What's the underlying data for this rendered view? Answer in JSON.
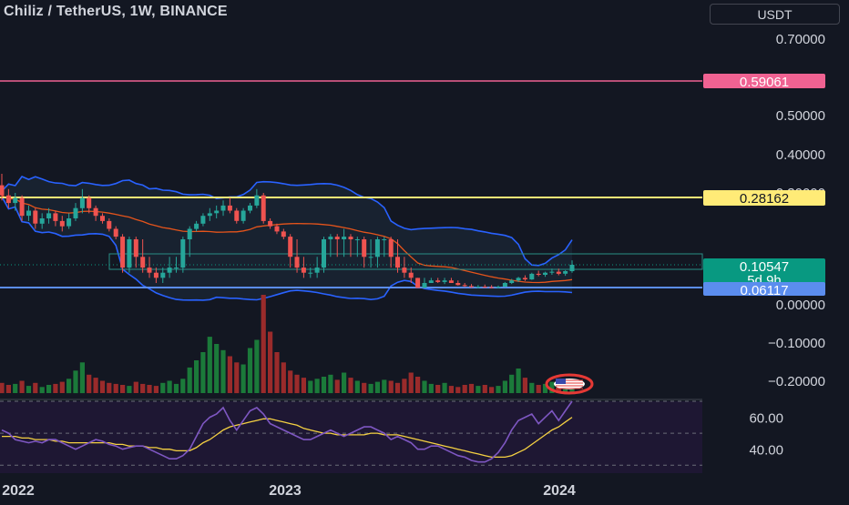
{
  "header": {
    "title": "Chiliz / TetherUS, 1W, BINANCE",
    "currency_label": "USDT"
  },
  "colors": {
    "background": "#131722",
    "up": "#26a69a",
    "down": "#ef5350",
    "bollinger": "#2962ff",
    "bollinger_fill": "#1e2b3d",
    "ma": "#e5541b",
    "rsi": "#7e57c2",
    "rsi_ma": "#f5d142",
    "resistance_pink": "#f06292",
    "resistance_yellow": "#ffeb77",
    "support_blue": "#5b8def",
    "last_price": "#089981"
  },
  "price_axis": {
    "ticks": [
      "0.70000",
      "0.50000",
      "0.40000",
      "0.30000",
      "0.00000",
      "−0.10000",
      "−0.20000"
    ]
  },
  "price_labels": {
    "pink": "0.59061",
    "yellow": "0.28162",
    "last": "0.10547",
    "countdown": "5d 9h",
    "blue": "0.06117"
  },
  "rsi_axis": {
    "ticks": [
      "60.00",
      "40.00"
    ]
  },
  "time_axis": {
    "labels": [
      "2022",
      "2023",
      "2024"
    ]
  },
  "chart_data": {
    "type": "candlestick",
    "title": "Chiliz / TetherUS, 1W, BINANCE",
    "horizontal_levels": [
      0.59061,
      0.28162,
      0.06117
    ],
    "last_price": 0.10547,
    "ylim": [
      -0.22,
      0.74
    ],
    "ohlc": [
      [
        0.32,
        0.35,
        0.27,
        0.29
      ],
      [
        0.29,
        0.31,
        0.24,
        0.26
      ],
      [
        0.26,
        0.3,
        0.23,
        0.28
      ],
      [
        0.28,
        0.29,
        0.19,
        0.21
      ],
      [
        0.21,
        0.25,
        0.19,
        0.23
      ],
      [
        0.23,
        0.24,
        0.16,
        0.18
      ],
      [
        0.18,
        0.22,
        0.16,
        0.2
      ],
      [
        0.2,
        0.24,
        0.18,
        0.22
      ],
      [
        0.22,
        0.23,
        0.17,
        0.19
      ],
      [
        0.19,
        0.21,
        0.15,
        0.17
      ],
      [
        0.17,
        0.22,
        0.16,
        0.2
      ],
      [
        0.2,
        0.26,
        0.19,
        0.24
      ],
      [
        0.24,
        0.31,
        0.22,
        0.28
      ],
      [
        0.28,
        0.29,
        0.22,
        0.24
      ],
      [
        0.24,
        0.25,
        0.19,
        0.21
      ],
      [
        0.21,
        0.22,
        0.18,
        0.19
      ],
      [
        0.19,
        0.2,
        0.15,
        0.16
      ],
      [
        0.16,
        0.17,
        0.12,
        0.13
      ],
      [
        0.13,
        0.14,
        0.09,
        0.1
      ],
      [
        0.1,
        0.13,
        0.09,
        0.12
      ],
      [
        0.12,
        0.13,
        0.1,
        0.11
      ],
      [
        0.11,
        0.12,
        0.09,
        0.1
      ],
      [
        0.1,
        0.11,
        0.08,
        0.09
      ],
      [
        0.09,
        0.1,
        0.07,
        0.08
      ],
      [
        0.08,
        0.1,
        0.07,
        0.09
      ],
      [
        0.09,
        0.11,
        0.08,
        0.1
      ],
      [
        0.1,
        0.11,
        0.09,
        0.1
      ],
      [
        0.1,
        0.13,
        0.09,
        0.12
      ],
      [
        0.12,
        0.17,
        0.11,
        0.16
      ],
      [
        0.16,
        0.19,
        0.15,
        0.18
      ],
      [
        0.18,
        0.22,
        0.17,
        0.21
      ],
      [
        0.21,
        0.24,
        0.19,
        0.22
      ],
      [
        0.22,
        0.25,
        0.2,
        0.23
      ],
      [
        0.23,
        0.27,
        0.21,
        0.25
      ],
      [
        0.25,
        0.28,
        0.22,
        0.23
      ],
      [
        0.23,
        0.24,
        0.18,
        0.19
      ],
      [
        0.19,
        0.24,
        0.18,
        0.23
      ],
      [
        0.23,
        0.26,
        0.22,
        0.25
      ],
      [
        0.25,
        0.31,
        0.24,
        0.29
      ],
      [
        0.29,
        0.3,
        0.18,
        0.19
      ],
      [
        0.19,
        0.2,
        0.16,
        0.17
      ],
      [
        0.17,
        0.18,
        0.14,
        0.15
      ],
      [
        0.15,
        0.16,
        0.12,
        0.13
      ],
      [
        0.13,
        0.14,
        0.1,
        0.11
      ],
      [
        0.11,
        0.12,
        0.09,
        0.1
      ],
      [
        0.1,
        0.11,
        0.08,
        0.09
      ],
      [
        0.09,
        0.1,
        0.08,
        0.09
      ],
      [
        0.09,
        0.11,
        0.08,
        0.1
      ],
      [
        0.1,
        0.13,
        0.09,
        0.12
      ],
      [
        0.12,
        0.14,
        0.11,
        0.13
      ],
      [
        0.13,
        0.14,
        0.11,
        0.12
      ],
      [
        0.12,
        0.16,
        0.11,
        0.13
      ],
      [
        0.13,
        0.14,
        0.11,
        0.12
      ],
      [
        0.12,
        0.13,
        0.11,
        0.12
      ],
      [
        0.12,
        0.13,
        0.1,
        0.11
      ],
      [
        0.11,
        0.12,
        0.1,
        0.11
      ],
      [
        0.11,
        0.13,
        0.1,
        0.12
      ],
      [
        0.12,
        0.13,
        0.11,
        0.12
      ],
      [
        0.12,
        0.13,
        0.1,
        0.11
      ],
      [
        0.11,
        0.12,
        0.09,
        0.1
      ],
      [
        0.1,
        0.11,
        0.08,
        0.09
      ],
      [
        0.09,
        0.1,
        0.07,
        0.08
      ],
      [
        0.08,
        0.08,
        0.06,
        0.06
      ],
      [
        0.06,
        0.08,
        0.06,
        0.07
      ],
      [
        0.07,
        0.08,
        0.07,
        0.075
      ],
      [
        0.075,
        0.08,
        0.07,
        0.072
      ],
      [
        0.072,
        0.08,
        0.068,
        0.075
      ],
      [
        0.075,
        0.08,
        0.07,
        0.07
      ],
      [
        0.07,
        0.075,
        0.065,
        0.066
      ],
      [
        0.066,
        0.07,
        0.062,
        0.064
      ],
      [
        0.064,
        0.068,
        0.06,
        0.062
      ],
      [
        0.062,
        0.066,
        0.058,
        0.063
      ],
      [
        0.063,
        0.067,
        0.06,
        0.062
      ],
      [
        0.062,
        0.066,
        0.058,
        0.061
      ],
      [
        0.061,
        0.065,
        0.058,
        0.063
      ],
      [
        0.063,
        0.072,
        0.062,
        0.07
      ],
      [
        0.07,
        0.078,
        0.068,
        0.075
      ],
      [
        0.075,
        0.082,
        0.072,
        0.08
      ],
      [
        0.08,
        0.085,
        0.074,
        0.077
      ],
      [
        0.077,
        0.09,
        0.076,
        0.088
      ],
      [
        0.088,
        0.094,
        0.083,
        0.086
      ],
      [
        0.086,
        0.092,
        0.082,
        0.09
      ],
      [
        0.09,
        0.098,
        0.086,
        0.092
      ],
      [
        0.092,
        0.098,
        0.085,
        0.088
      ],
      [
        0.088,
        0.095,
        0.084,
        0.093
      ],
      [
        0.093,
        0.108,
        0.09,
        0.10547
      ]
    ],
    "volume": [
      10,
      8,
      9,
      12,
      7,
      10,
      6,
      8,
      9,
      11,
      14,
      22,
      30,
      18,
      15,
      12,
      10,
      9,
      8,
      7,
      11,
      9,
      8,
      7,
      10,
      12,
      9,
      14,
      25,
      32,
      40,
      55,
      48,
      42,
      36,
      30,
      28,
      44,
      52,
      96,
      60,
      40,
      30,
      22,
      18,
      15,
      12,
      14,
      16,
      18,
      13,
      20,
      15,
      12,
      10,
      9,
      11,
      13,
      12,
      10,
      14,
      20,
      16,
      12,
      9,
      8,
      10,
      7,
      6,
      8,
      9,
      7,
      8,
      6,
      7,
      12,
      18,
      24,
      15,
      10,
      8,
      9,
      11,
      13,
      10,
      12
    ],
    "rsi": [
      52,
      50,
      46,
      45,
      44,
      45,
      44,
      46,
      46,
      44,
      42,
      40,
      42,
      44,
      46,
      45,
      43,
      42,
      40,
      41,
      42,
      42,
      40,
      38,
      36,
      34,
      34,
      36,
      40,
      48,
      56,
      60,
      62,
      66,
      58,
      52,
      58,
      64,
      66,
      62,
      56,
      54,
      52,
      50,
      48,
      46,
      46,
      48,
      50,
      52,
      50,
      48,
      50,
      52,
      54,
      54,
      52,
      50,
      46,
      48,
      46,
      44,
      40,
      40,
      42,
      42,
      40,
      38,
      36,
      35,
      33,
      32,
      32,
      34,
      38,
      44,
      52,
      58,
      60,
      62,
      56,
      60,
      64,
      58,
      64,
      70
    ],
    "rsi_ma": [
      48,
      48,
      48,
      47,
      47,
      46,
      46,
      46,
      45,
      45,
      44,
      44,
      44,
      44,
      44,
      44,
      44,
      43,
      43,
      42,
      42,
      42,
      41,
      41,
      40,
      40,
      39,
      39,
      39,
      41,
      44,
      46,
      49,
      52,
      54,
      55,
      56,
      57,
      58,
      59,
      59,
      58,
      57,
      56,
      55,
      53,
      52,
      51,
      50,
      50,
      49,
      49,
      49,
      49,
      49,
      50,
      50,
      49,
      49,
      49,
      48,
      47,
      46,
      45,
      44,
      43,
      42,
      41,
      40,
      39,
      38,
      37,
      36,
      35,
      35,
      35,
      36,
      38,
      40,
      43,
      46,
      49,
      52,
      54,
      57,
      60
    ]
  }
}
